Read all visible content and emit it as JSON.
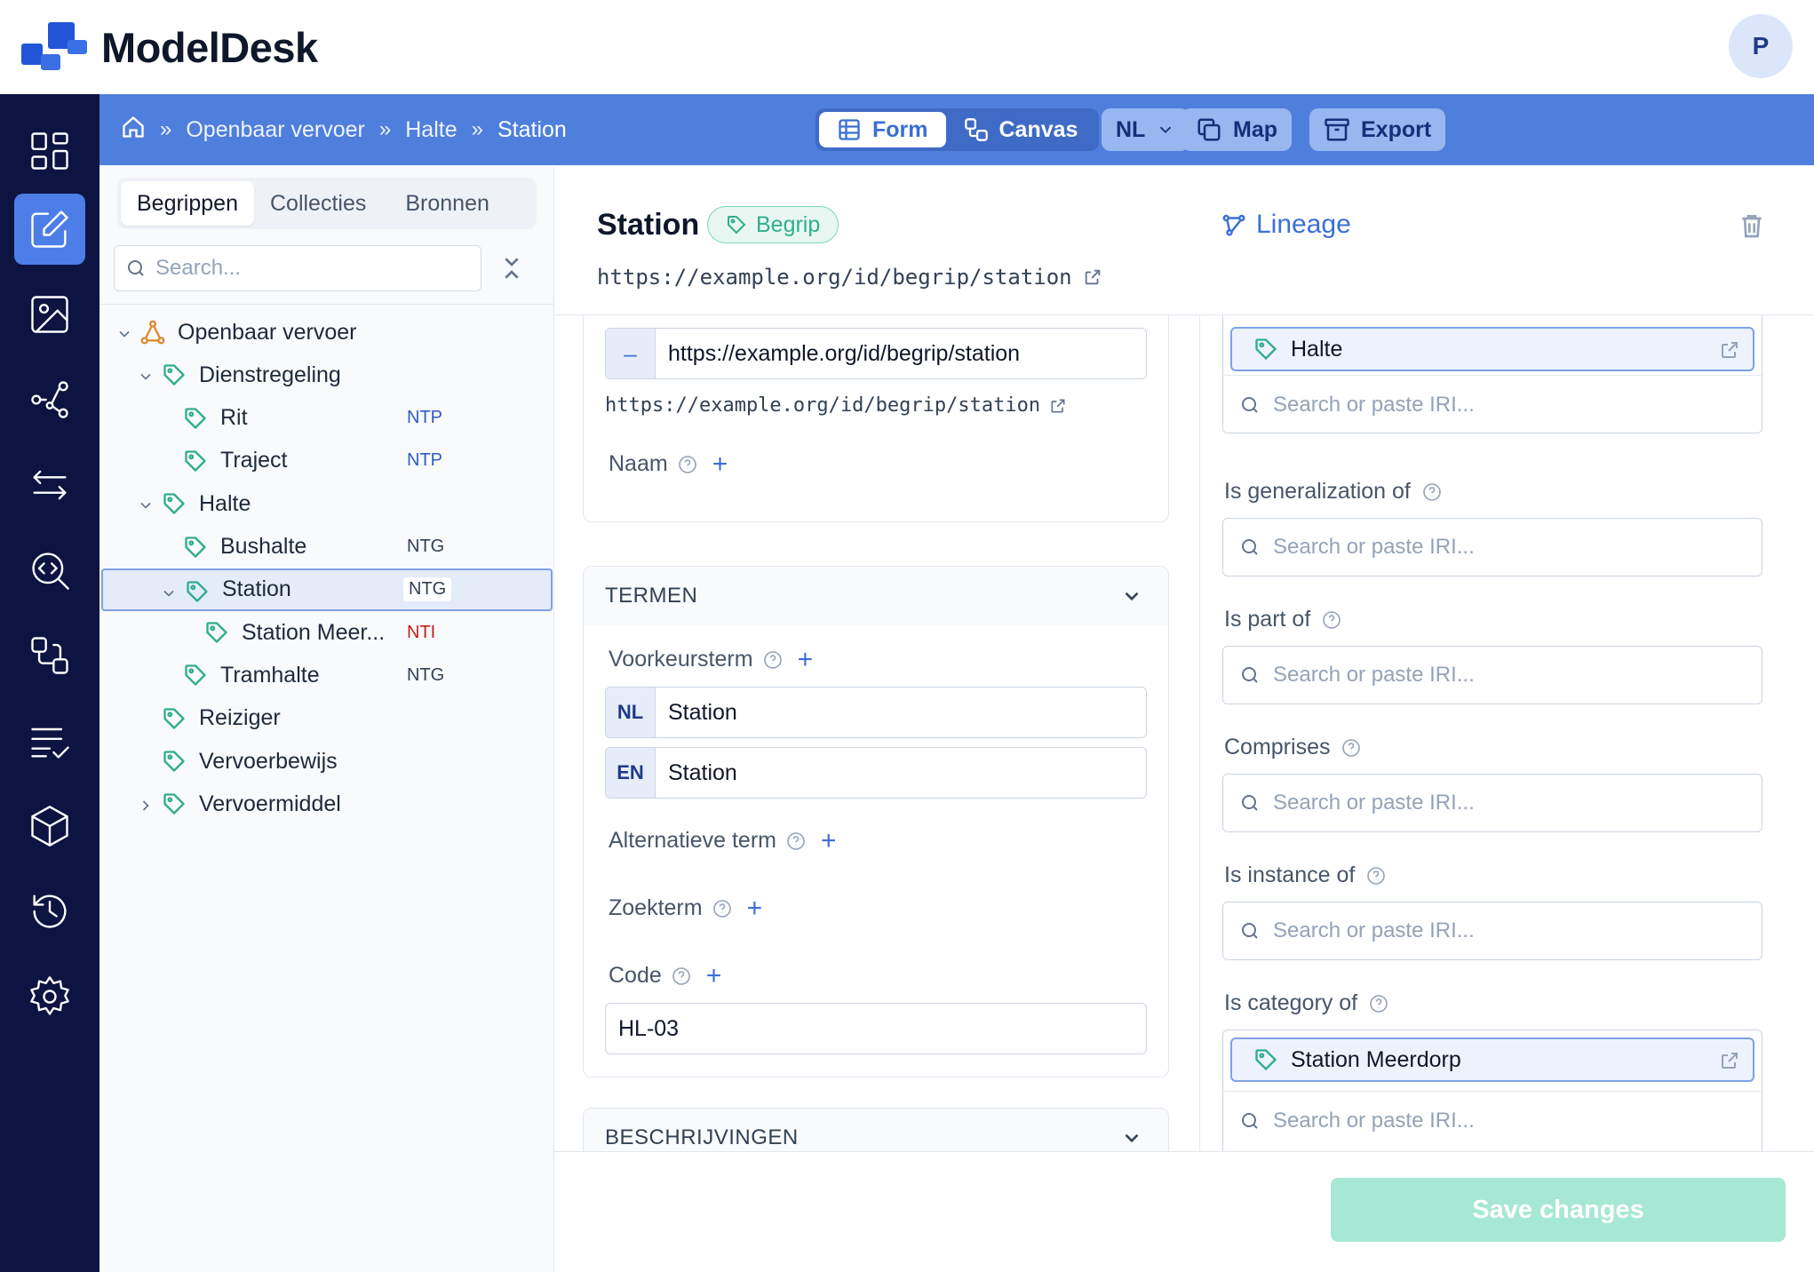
{
  "app": {
    "name": "ModelDesk",
    "user_initial": "P"
  },
  "breadcrumb": [
    "Openbaar vervoer",
    "Halte",
    "Station"
  ],
  "view_toggle": {
    "form": "Form",
    "canvas": "Canvas",
    "active": "form"
  },
  "header_actions": {
    "language": "NL",
    "map": "Map",
    "export": "Export"
  },
  "sidebar": {
    "tabs": [
      "Begrippen",
      "Collecties",
      "Bronnen"
    ],
    "active_tab": "Begrippen",
    "search_placeholder": "Search...",
    "tree": [
      {
        "label": "Openbaar vervoer",
        "level": 0,
        "expanded": true,
        "icon": "hierarchy-icon",
        "badge": ""
      },
      {
        "label": "Dienstregeling",
        "level": 1,
        "expanded": true,
        "icon": "tag-icon",
        "badge": ""
      },
      {
        "label": "Rit",
        "level": 2,
        "icon": "tag-icon",
        "badge": "NTP"
      },
      {
        "label": "Traject",
        "level": 2,
        "icon": "tag-icon",
        "badge": "NTP"
      },
      {
        "label": "Halte",
        "level": 1,
        "expanded": true,
        "icon": "tag-icon",
        "badge": ""
      },
      {
        "label": "Bushalte",
        "level": 2,
        "icon": "tag-icon",
        "badge": "NTG"
      },
      {
        "label": "Station",
        "level": 2,
        "expanded": true,
        "selected": true,
        "icon": "tag-icon",
        "badge": "NTG"
      },
      {
        "label": "Station Meer...",
        "level": 3,
        "icon": "tag-icon",
        "badge": "NTI"
      },
      {
        "label": "Tramhalte",
        "level": 2,
        "icon": "tag-icon",
        "badge": "NTG"
      },
      {
        "label": "Reiziger",
        "level": 1,
        "icon": "tag-icon",
        "badge": ""
      },
      {
        "label": "Vervoerbewijs",
        "level": 1,
        "icon": "tag-icon",
        "badge": ""
      },
      {
        "label": "Vervoermiddel",
        "level": 1,
        "expanded": false,
        "icon": "tag-icon",
        "badge": ""
      }
    ]
  },
  "concept": {
    "title": "Station",
    "type_badge": "Begrip",
    "lineage_label": "Lineage",
    "iri": "https://example.org/id/begrip/station"
  },
  "form": {
    "iri_input": {
      "prefix": "–",
      "value": "https://example.org/id/begrip/station",
      "display": "https://example.org/id/begrip/station"
    },
    "naam_label": "Naam",
    "termen": {
      "header": "TERMEN",
      "voorkeursterm_label": "Voorkeursterm",
      "voorkeursterm": [
        {
          "lang": "NL",
          "value": "Station"
        },
        {
          "lang": "EN",
          "value": "Station"
        }
      ],
      "alternatieve_label": "Alternatieve term",
      "zoekterm_label": "Zoekterm",
      "code_label": "Code",
      "code_value": "HL-03"
    },
    "beschrijvingen_header": "BESCHRIJVINGEN"
  },
  "relations": {
    "search_placeholder": "Search or paste IRI...",
    "broader_chip": "Halte",
    "generalization_label": "Is generalization of",
    "part_of_label": "Is part of",
    "comprises_label": "Comprises",
    "instance_of_label": "Is instance of",
    "category_of_label": "Is category of",
    "category_chip": "Station Meerdorp"
  },
  "save_label": "Save changes",
  "colors": {
    "brand_blue": "#4f7fdc",
    "rail": "#0d1442",
    "accent_green": "#2fae8c",
    "save_disabled": "#a7e8d4"
  }
}
